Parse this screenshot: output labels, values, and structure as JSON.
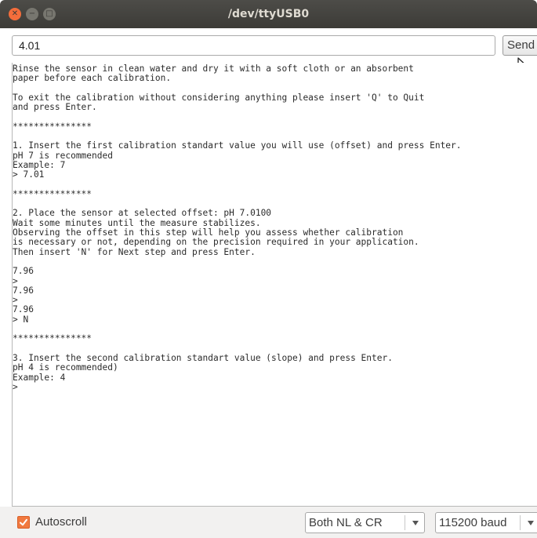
{
  "window": {
    "title": "/dev/ttyUSB0"
  },
  "toolbar": {
    "input_value": "4.01",
    "send_label": "Send"
  },
  "console": {
    "lines": [
      "Rinse the sensor in clean water and dry it with a soft cloth or an absorbent",
      "paper before each calibration.",
      "",
      "To exit the calibration without considering anything please insert 'Q' to Quit",
      "and press Enter.",
      "",
      "***************",
      "",
      "1. Insert the first calibration standart value you will use (offset) and press Enter.",
      "pH 7 is recommended",
      "Example: 7",
      "> 7.01",
      "",
      "***************",
      "",
      "2. Place the sensor at selected offset: pH 7.0100",
      "Wait some minutes until the measure stabilizes.",
      "Observing the offset in this step will help you assess whether calibration",
      "is necessary or not, depending on the precision required in your application.",
      "Then insert 'N' for Next step and press Enter.",
      "",
      "7.96",
      ">",
      "7.96",
      ">",
      "7.96",
      "> N",
      "",
      "***************",
      "",
      "3. Insert the second calibration standart value (slope) and press Enter.",
      "pH 4 is recommended)",
      "Example: 4",
      ">"
    ]
  },
  "footer": {
    "autoscroll_label": "Autoscroll",
    "autoscroll_checked": true,
    "line_ending_value": "Both NL & CR",
    "baud_value": "115200 baud"
  },
  "colors": {
    "titlebar": "#3c3b37",
    "close_button": "#f46d3b",
    "checkbox_accent": "#f1793f"
  },
  "icons": {
    "close": "close-icon",
    "minimize": "minimize-icon",
    "maximize": "maximize-icon",
    "cursor": "mouse-pointer-icon",
    "checkbox": "check-icon",
    "dropdown": "chevron-down-icon"
  }
}
